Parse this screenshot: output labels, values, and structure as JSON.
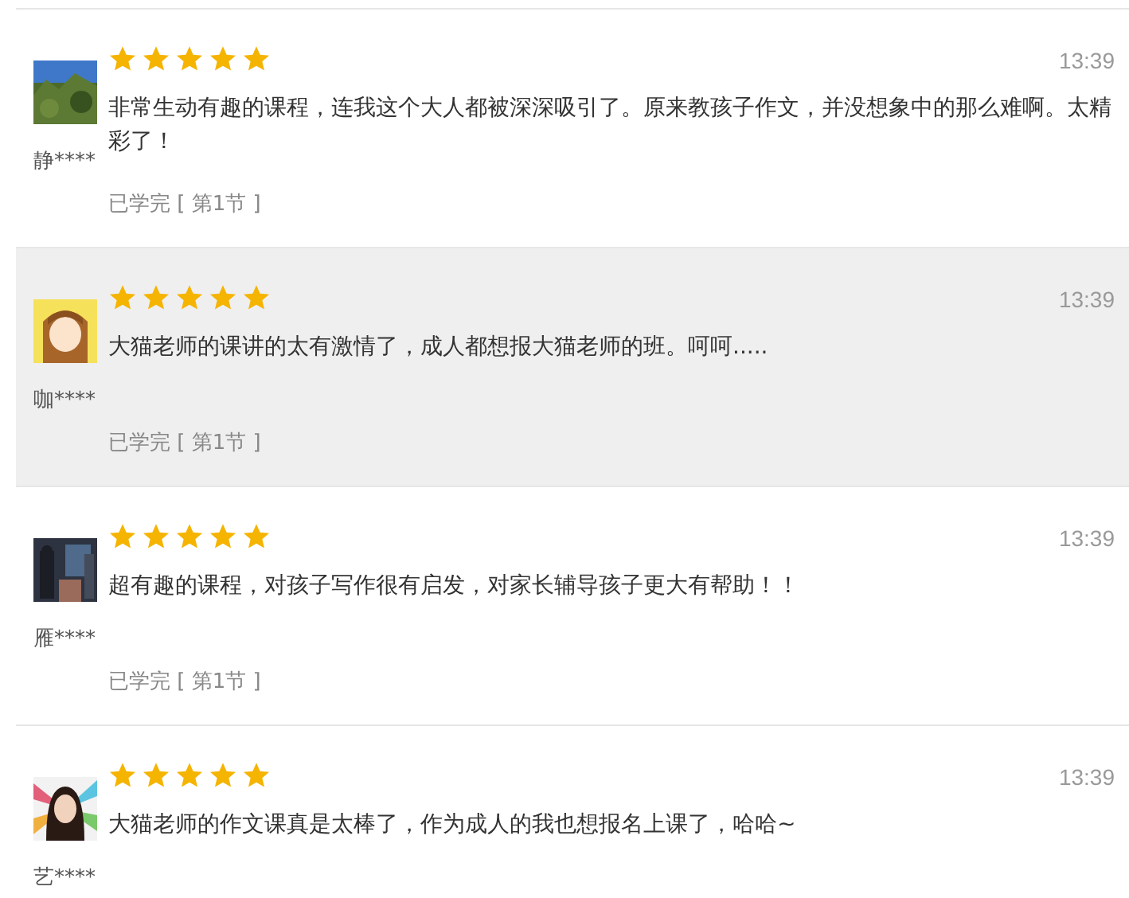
{
  "reviews": [
    {
      "name": "静****",
      "stars": 5,
      "time": "13:39",
      "text": "非常生动有趣的课程，连我这个大人都被深深吸引了。原来教孩子作文，并没想象中的那么难啊。太精彩了！",
      "status": "已学完 [ 第1节 ]",
      "highlighted": false
    },
    {
      "name": "咖****",
      "stars": 5,
      "time": "13:39",
      "text": "大猫老师的课讲的太有激情了，成人都想报大猫老师的班。呵呵.....",
      "status": "已学完 [ 第1节 ]",
      "highlighted": true
    },
    {
      "name": "雁****",
      "stars": 5,
      "time": "13:39",
      "text": "超有趣的课程，对孩子写作很有启发，对家长辅导孩子更大有帮助！！",
      "status": "已学完 [ 第1节 ]",
      "highlighted": false
    },
    {
      "name": "艺****",
      "stars": 5,
      "time": "13:39",
      "text": "大猫老师的作文课真是太棒了，作为成人的我也想报名上课了，哈哈~",
      "highlighted": false
    }
  ]
}
